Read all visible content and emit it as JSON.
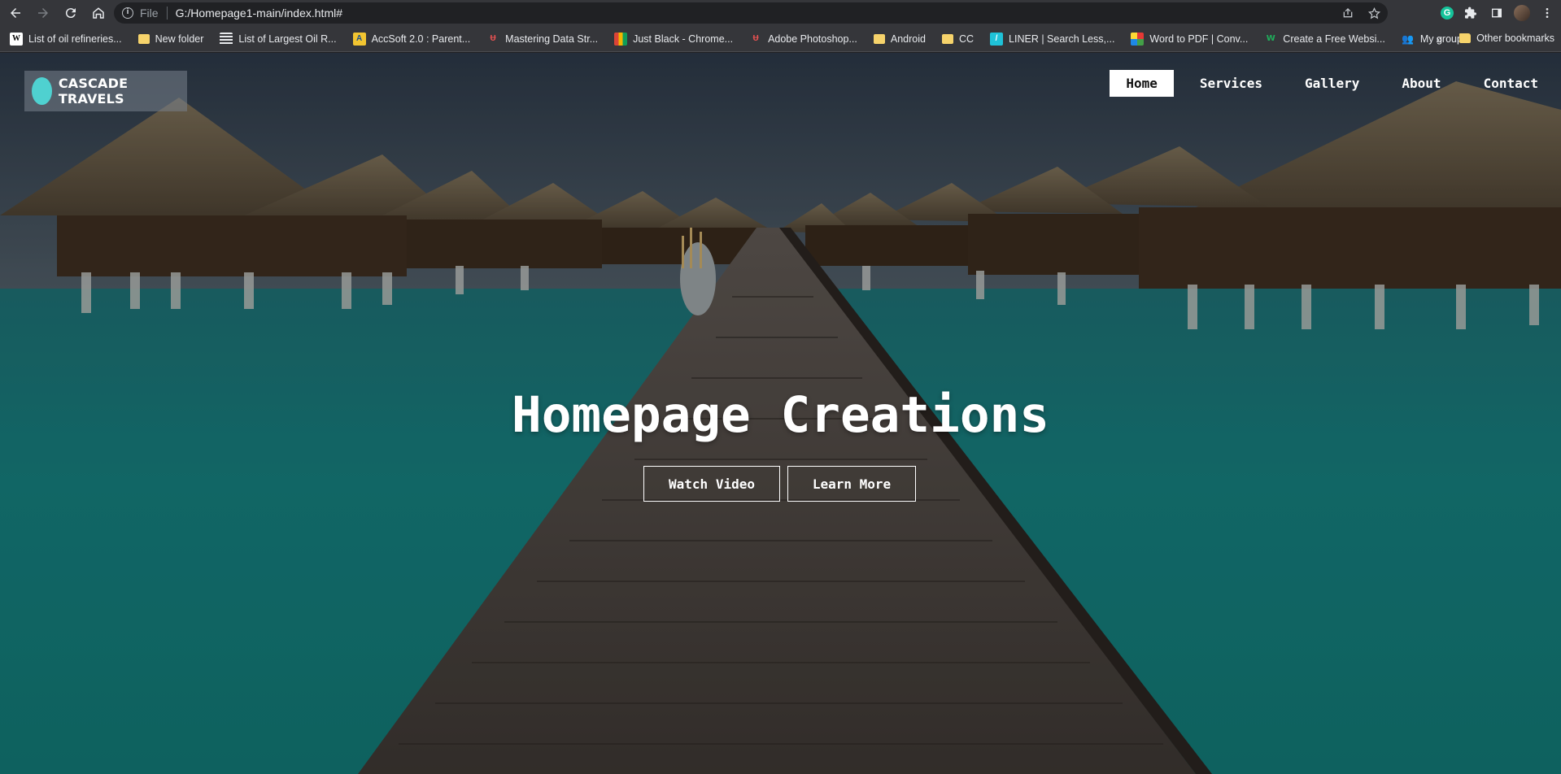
{
  "browser": {
    "url_scheme": "File",
    "url": "G:/Homepage1-main/index.html#",
    "icons": [
      "back-icon",
      "forward-icon",
      "reload-icon",
      "home-icon",
      "info-icon",
      "share-icon",
      "star-icon",
      "grammarly-icon",
      "extensions-icon",
      "sidepanel-icon",
      "profile-avatar",
      "menu-icon"
    ]
  },
  "bookmarks": {
    "items": [
      {
        "label": "List of oil refineries...",
        "icon": "wikipedia-icon"
      },
      {
        "label": "New folder",
        "icon": "folder-icon"
      },
      {
        "label": "List of Largest Oil R...",
        "icon": "list-icon"
      },
      {
        "label": "AccSoft 2.0 : Parent...",
        "icon": "accsoft-icon"
      },
      {
        "label": "Mastering Data Str...",
        "icon": "udemy-icon"
      },
      {
        "label": "Just Black - Chrome...",
        "icon": "chrome-store-icon"
      },
      {
        "label": "Adobe Photoshop...",
        "icon": "udemy-icon"
      },
      {
        "label": "Android",
        "icon": "folder-icon"
      },
      {
        "label": "CC",
        "icon": "folder-icon"
      },
      {
        "label": "LINER | Search Less,...",
        "icon": "liner-icon"
      },
      {
        "label": "Word to PDF | Conv...",
        "icon": "ilovepdf-icon"
      },
      {
        "label": "Create a Free Websi...",
        "icon": "wix-icon"
      },
      {
        "label": "My groups",
        "icon": "groups-icon"
      }
    ],
    "overflow": "»",
    "other": "Other bookmarks"
  },
  "site": {
    "logo_text": "CASCADE TRAVELS",
    "nav": [
      "Home",
      "Services",
      "Gallery",
      "About",
      "Contact"
    ],
    "active_nav": "Home",
    "hero_title": "Homepage Creations",
    "buttons": {
      "watch": "Watch Video",
      "learn": "Learn More"
    }
  },
  "colors": {
    "accent": "#4fd1d0",
    "water": "#1a8c8a",
    "chrome_bg": "#35363a"
  }
}
